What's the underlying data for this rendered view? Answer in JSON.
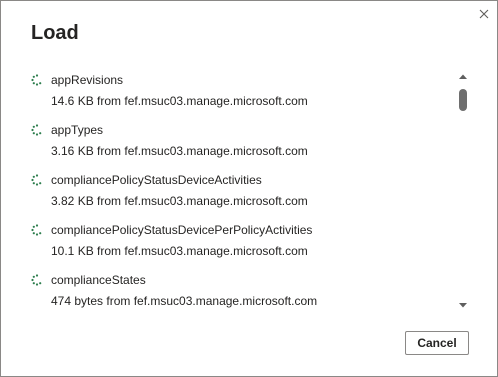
{
  "dialog": {
    "title": "Load",
    "close_icon": "close-icon",
    "cancel_label": "Cancel"
  },
  "items": [
    {
      "name": "appRevisions",
      "detail": "14.6 KB from fef.msuc03.manage.microsoft.com"
    },
    {
      "name": "appTypes",
      "detail": "3.16 KB from fef.msuc03.manage.microsoft.com"
    },
    {
      "name": "compliancePolicyStatusDeviceActivities",
      "detail": "3.82 KB from fef.msuc03.manage.microsoft.com"
    },
    {
      "name": "compliancePolicyStatusDevicePerPolicyActivities",
      "detail": "10.1 KB from fef.msuc03.manage.microsoft.com"
    },
    {
      "name": "complianceStates",
      "detail": "474 bytes from fef.msuc03.manage.microsoft.com"
    }
  ],
  "colors": {
    "spinner": "#2f7f4f",
    "text": "#252423",
    "border": "#8a8886",
    "scroll_thumb": "#6e6e6e"
  }
}
